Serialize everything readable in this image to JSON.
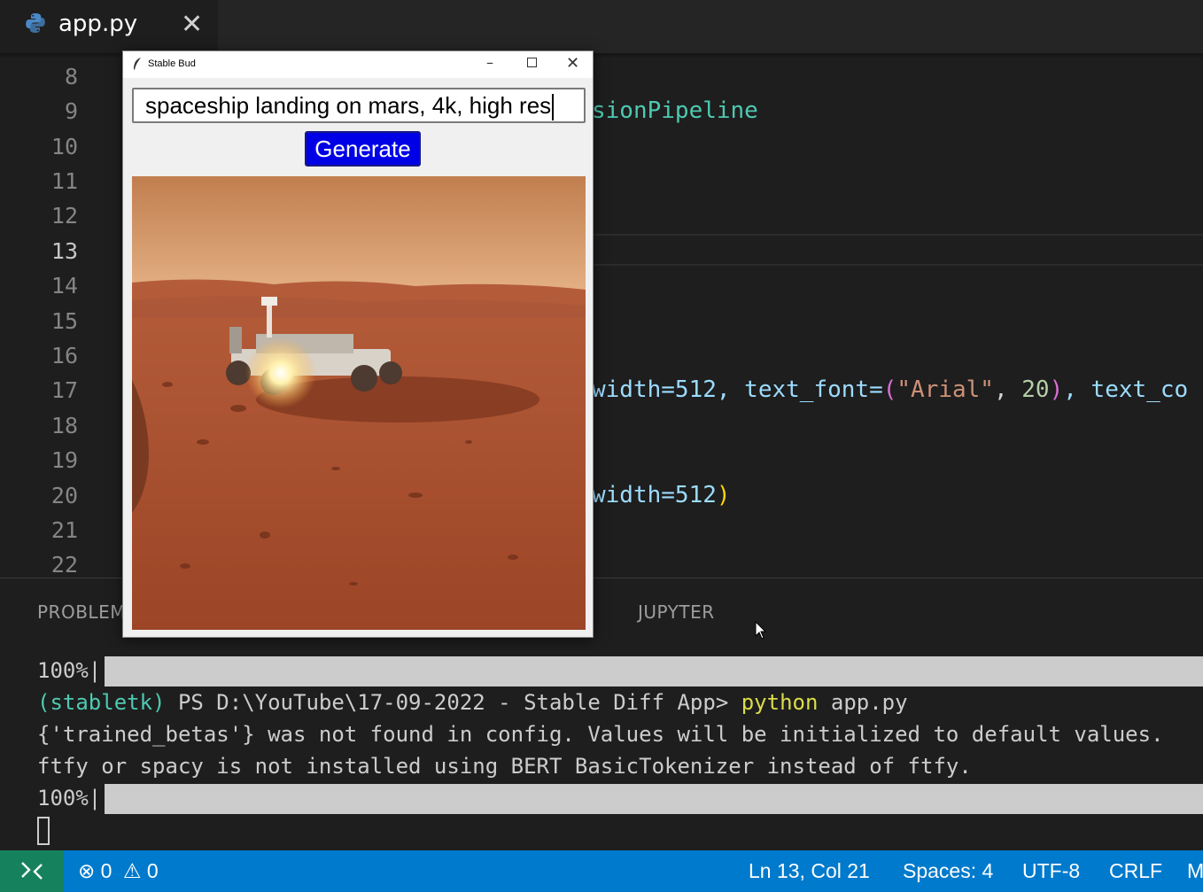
{
  "editor_tab": {
    "filename": "app.py",
    "icon": "python-icon",
    "close_icon": "close-icon"
  },
  "editor": {
    "line_numbers": [
      "8",
      "9",
      "10",
      "11",
      "12",
      "13",
      "14",
      "15",
      "16",
      "17",
      "18",
      "19",
      "20",
      "21",
      "22"
    ],
    "active_line": "13",
    "code_fragments": {
      "line9": "sionPipeline",
      "line17": {
        "a": "width=512, text_font=",
        "paren_open": "(",
        "str": "\"Arial\"",
        "comma": ", ",
        "num": "20",
        "paren_close": ")",
        "tail": ", text_co"
      },
      "line20": {
        "a": "width=512",
        "paren_close": ")"
      }
    }
  },
  "panel": {
    "tabs": [
      "PROBLEMS",
      "JUPYTER"
    ],
    "terminal": {
      "progress_1": "100%|",
      "prompt_env": "(stabletk)",
      "prompt_path": " PS D:\\YouTube\\17-09-2022 - Stable Diff App> ",
      "command": "python",
      "command_args": " app.py",
      "line_3": "{'trained_betas'} was not found in config. Values will be initialized to default values.",
      "line_4": "ftfy or spacy is not installed using BERT BasicTokenizer instead of ftfy.",
      "progress_2": "100%|"
    }
  },
  "statusbar": {
    "errors": "0",
    "warnings": "0",
    "position": "Ln 13, Col 21",
    "spaces": "Spaces: 4",
    "encoding": "UTF-8",
    "eol": "CRLF",
    "mode": "M"
  },
  "tk_window": {
    "title": "Stable Bud",
    "prompt_value": "spaceship landing on mars, 4k, high res",
    "generate_label": "Generate"
  },
  "colors": {
    "accent": "#007acc",
    "remote": "#16825d",
    "button": "#0000e6"
  }
}
